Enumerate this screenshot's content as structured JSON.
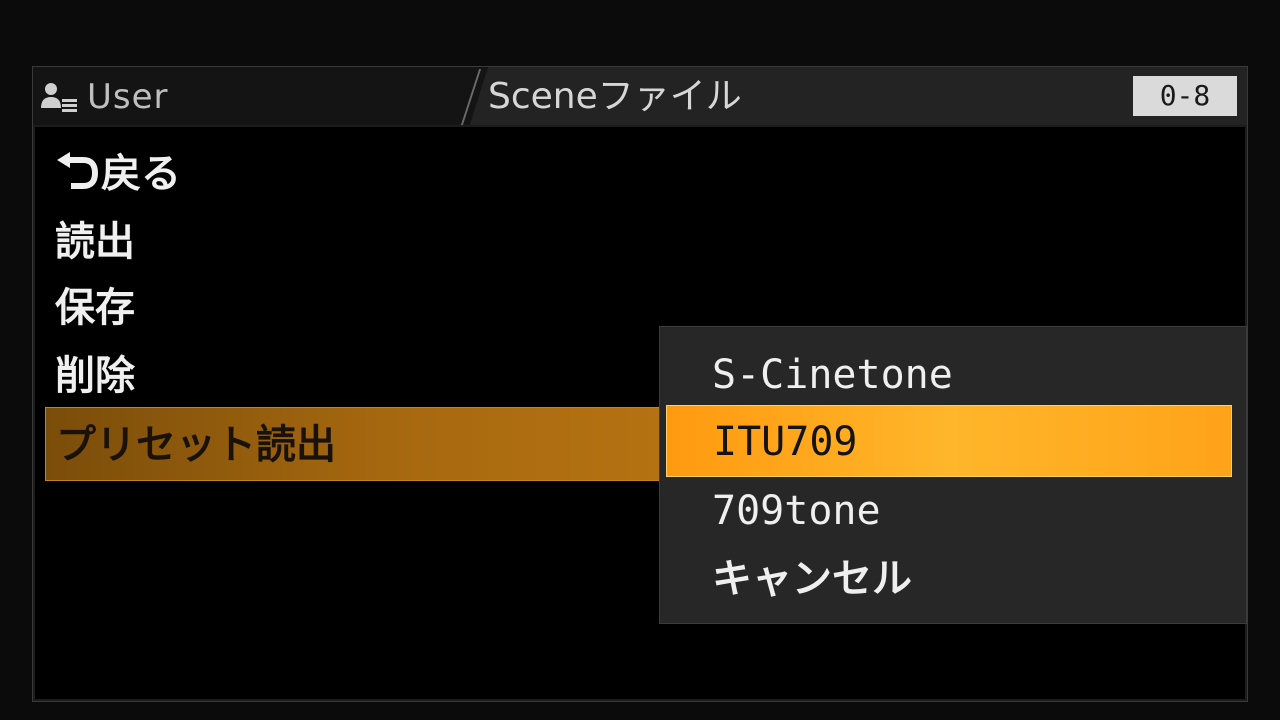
{
  "header": {
    "user_tab": "User",
    "title": "Sceneファイル",
    "page": "0-8",
    "user_icon": "user-list-icon"
  },
  "menu": {
    "back_icon": "return-arrow-icon",
    "items": [
      {
        "label": "戻る"
      },
      {
        "label": "読出"
      },
      {
        "label": "保存"
      },
      {
        "label": "削除"
      },
      {
        "label": "プリセット読出"
      }
    ],
    "selected_index": 4
  },
  "popup": {
    "options": [
      {
        "label": "S-Cinetone"
      },
      {
        "label": "ITU709"
      },
      {
        "label": "709tone"
      },
      {
        "label": "キャンセル"
      }
    ],
    "selected_index": 1
  },
  "colors": {
    "menu_selected": "#a6680f",
    "popup_selected": "#ffb62a",
    "background": "#000000"
  }
}
